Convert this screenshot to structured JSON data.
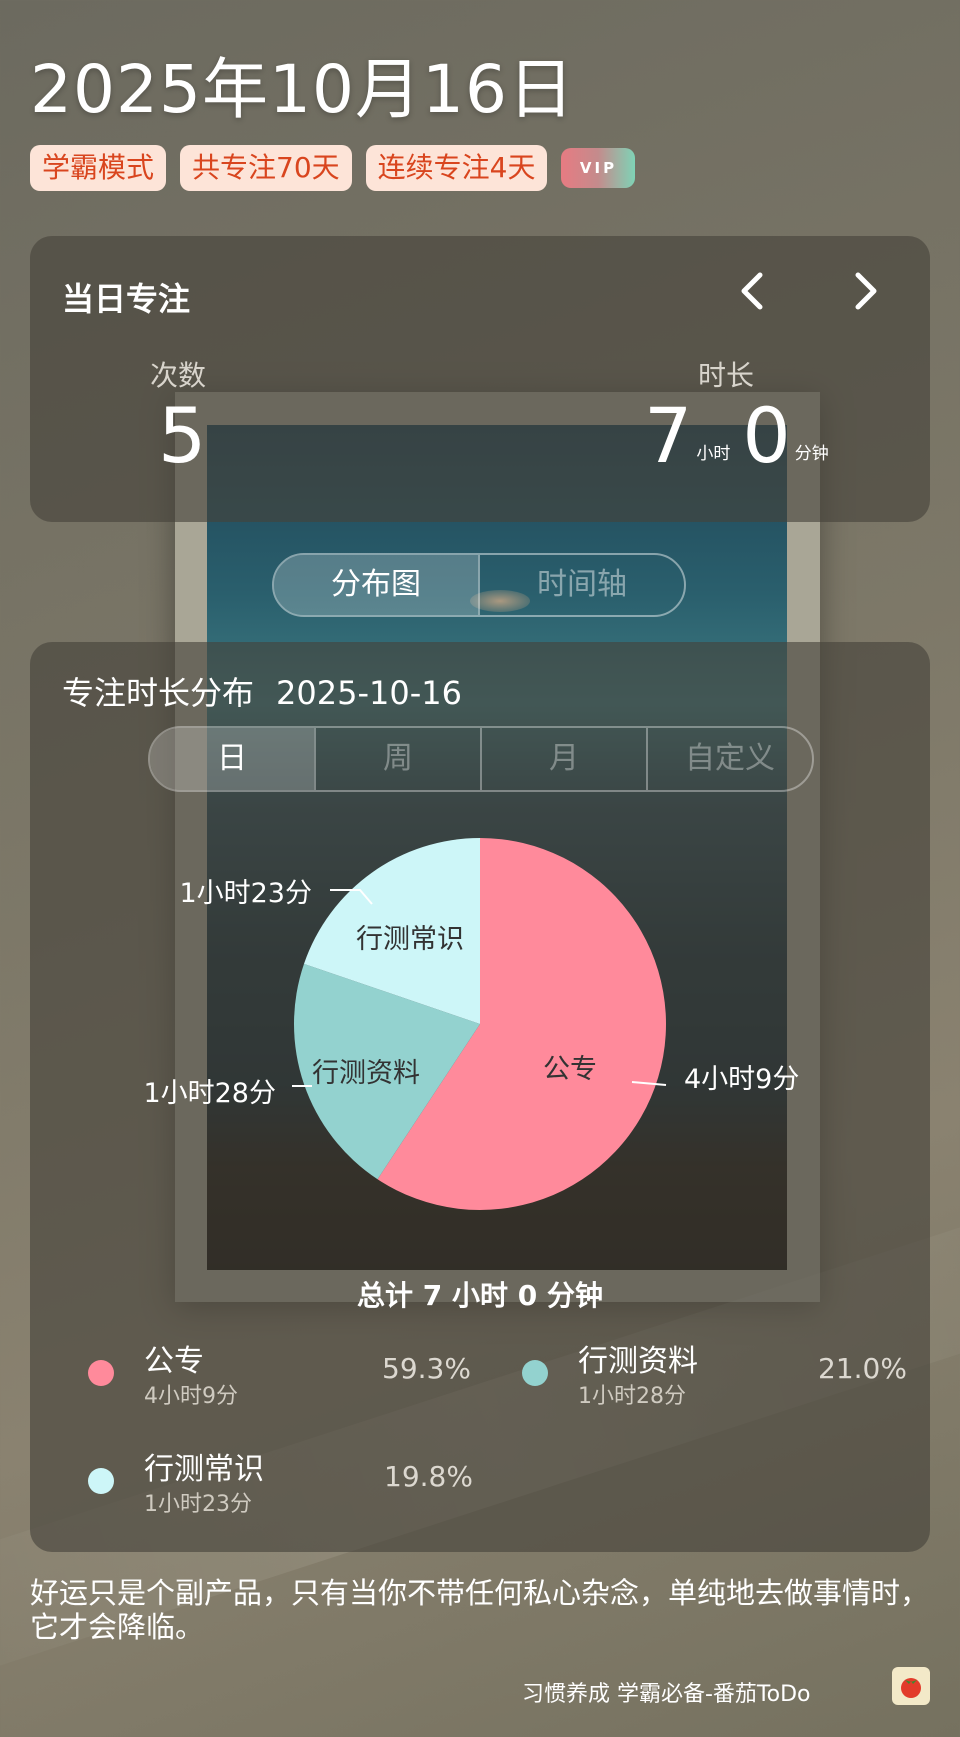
{
  "header": {
    "date": "2025年10月16日",
    "badges": [
      "学霸模式",
      "共专注70天",
      "连续专注4天"
    ],
    "vip_label": "VIP"
  },
  "today": {
    "title": "当日专注",
    "count_label": "次数",
    "count_value": "5",
    "duration_label": "时长",
    "hours": "7",
    "hours_unit": "小时",
    "minutes": "0",
    "minutes_unit": "分钟"
  },
  "view_switch": {
    "options": [
      "分布图",
      "时间轴"
    ],
    "selected": "分布图"
  },
  "distribution": {
    "title": "专注时长分布",
    "date": "2025-10-16",
    "ranges": [
      "日",
      "周",
      "月",
      "自定义"
    ],
    "selected_range": "日",
    "total": "总计 7 小时 0 分钟"
  },
  "chart_data": {
    "type": "pie",
    "title": "",
    "slices": [
      {
        "label": "公专",
        "value": 249,
        "duration": "4小时9分",
        "percent": "59.3%",
        "color": "#ff8a9b"
      },
      {
        "label": "行测资料",
        "value": 88,
        "duration": "1小时28分",
        "percent": "21.0%",
        "color": "#93d2cf"
      },
      {
        "label": "行测常识",
        "value": 83,
        "duration": "1小时23分",
        "percent": "19.8%",
        "color": "#cdf6f8"
      }
    ]
  },
  "quote": "好运只是个副产品，只有当你不带任何私心杂念，单纯地去做事情时，它才会降临。",
  "footer": {
    "brand": "习惯养成 学霸必备-番茄ToDo"
  }
}
